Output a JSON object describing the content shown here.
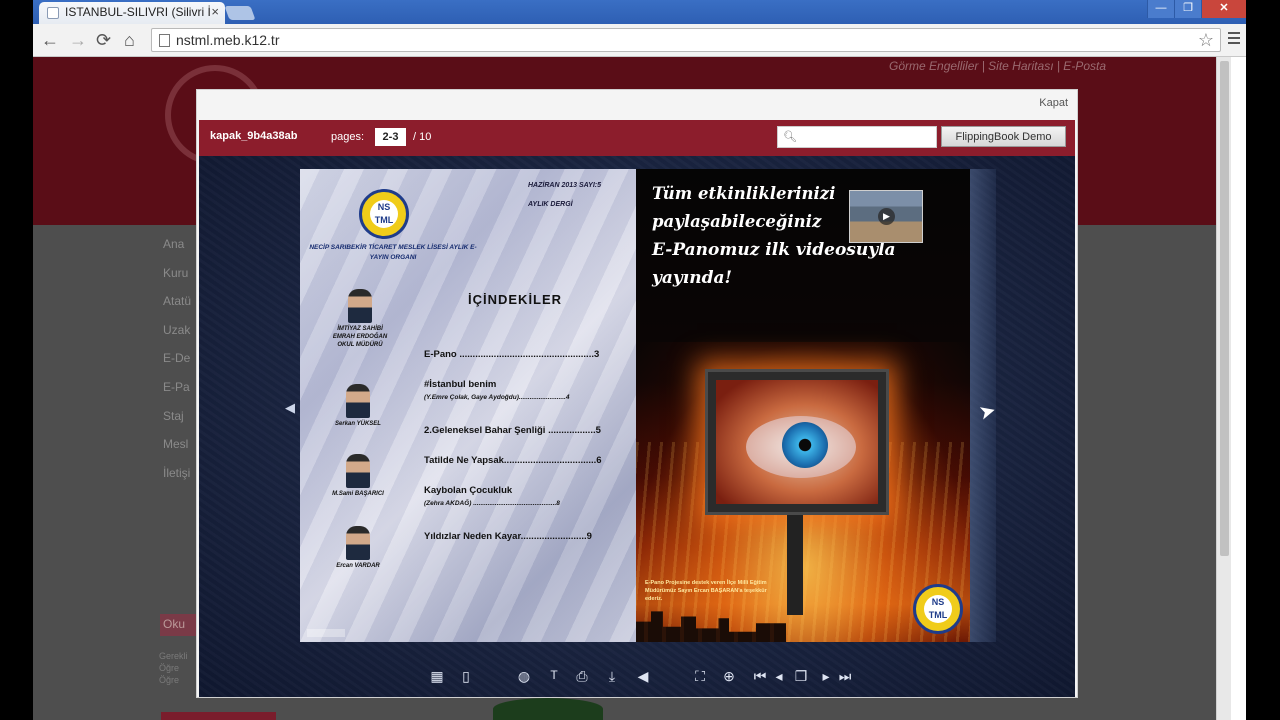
{
  "browser": {
    "tab_title": "ISTANBUL-SILIVRI (Silivri İ",
    "tab_close": "×",
    "url": "nstml.meb.k12.tr",
    "window_controls": {
      "minimize": "—",
      "maximize": "❐",
      "close": "✕"
    },
    "nav": {
      "back": "←",
      "forward": "→",
      "reload": "⟳",
      "home": "⌂",
      "star": "☆"
    }
  },
  "site": {
    "top_links": "Görme Engelliler | Site Haritası | E-Posta",
    "side_menu": [
      "Ana",
      "Kuru",
      "Atatü",
      "Uzak",
      "E-De",
      "E-Pa",
      "Staj",
      "Mesl",
      "İletişi"
    ],
    "oku_label": "Oku",
    "oku_lines": [
      "Gerekli",
      "Öğre",
      "Öğre"
    ]
  },
  "flippingbook": {
    "close_label": "Kapat",
    "book_title": "kapak_9b4a38ab",
    "pages_label": "pages:",
    "current_pages": "2-3",
    "total_pages": "/ 10",
    "search_icon": "magnifier-icon",
    "demo_button": "FlippingBook Demo",
    "prev_arrow": "◀",
    "toolbar_icons": [
      "thumbnails-icon",
      "bookmark-icon",
      "globe-icon",
      "text-icon",
      "print-icon",
      "download-icon",
      "sound-icon",
      "fullscreen-icon",
      "zoom-icon",
      "first-page-icon",
      "prev-page-icon",
      "flip-icon",
      "next-page-icon",
      "last-page-icon"
    ]
  },
  "left_page": {
    "logo_text": "NS\nTML",
    "date": "HAZİRAN 2013   SAYI:5",
    "monthly": "AYLIK DERGİ",
    "school": "NECİP SARIBEKİR TİCARET MESLEK LİSESİ AYLIK E-YAYIN ORGANI",
    "toc_title": "İÇİNDEKİLER",
    "staff": [
      {
        "caption": "İMTİYAZ SAHİBİ\nEMRAH ERDOĞAN\nOKUL MÜDÜRÜ"
      },
      {
        "caption": "Serkan YÜKSEL"
      },
      {
        "caption": "M.Sami BAŞARICI"
      },
      {
        "caption": "Ercan VARDAR"
      }
    ],
    "toc": [
      {
        "title": "E-Pano ...................................................3",
        "sub": ""
      },
      {
        "title": "#İstanbul benim",
        "sub": "(Y.Emre Çolak, Gaye Aydoğdu)..........................4"
      },
      {
        "title": "2.Geleneksel Bahar Şenliği ..................5",
        "sub": ""
      },
      {
        "title": "Tatilde Ne Yapsak...................................6",
        "sub": ""
      },
      {
        "title": "Kaybolan Çocukluk",
        "sub": "(Zehra AKDAĞ) ..............................................8"
      },
      {
        "title": "Yıldızlar Neden Kayar.........................9",
        "sub": ""
      }
    ]
  },
  "right_page": {
    "headline_1": "Tüm etkinliklerinizi",
    "headline_2": "paylaşabileceğiniz",
    "headline_3": "E-Panomuz ilk videosuyla yayında!",
    "small_text": "E-Pano Projesine destek veren İlçe Milli Eğitim Müdürümüz Sayın Ercan BAŞARAN'a teşekkür ederiz.",
    "logo_text": "NS\nTML"
  }
}
